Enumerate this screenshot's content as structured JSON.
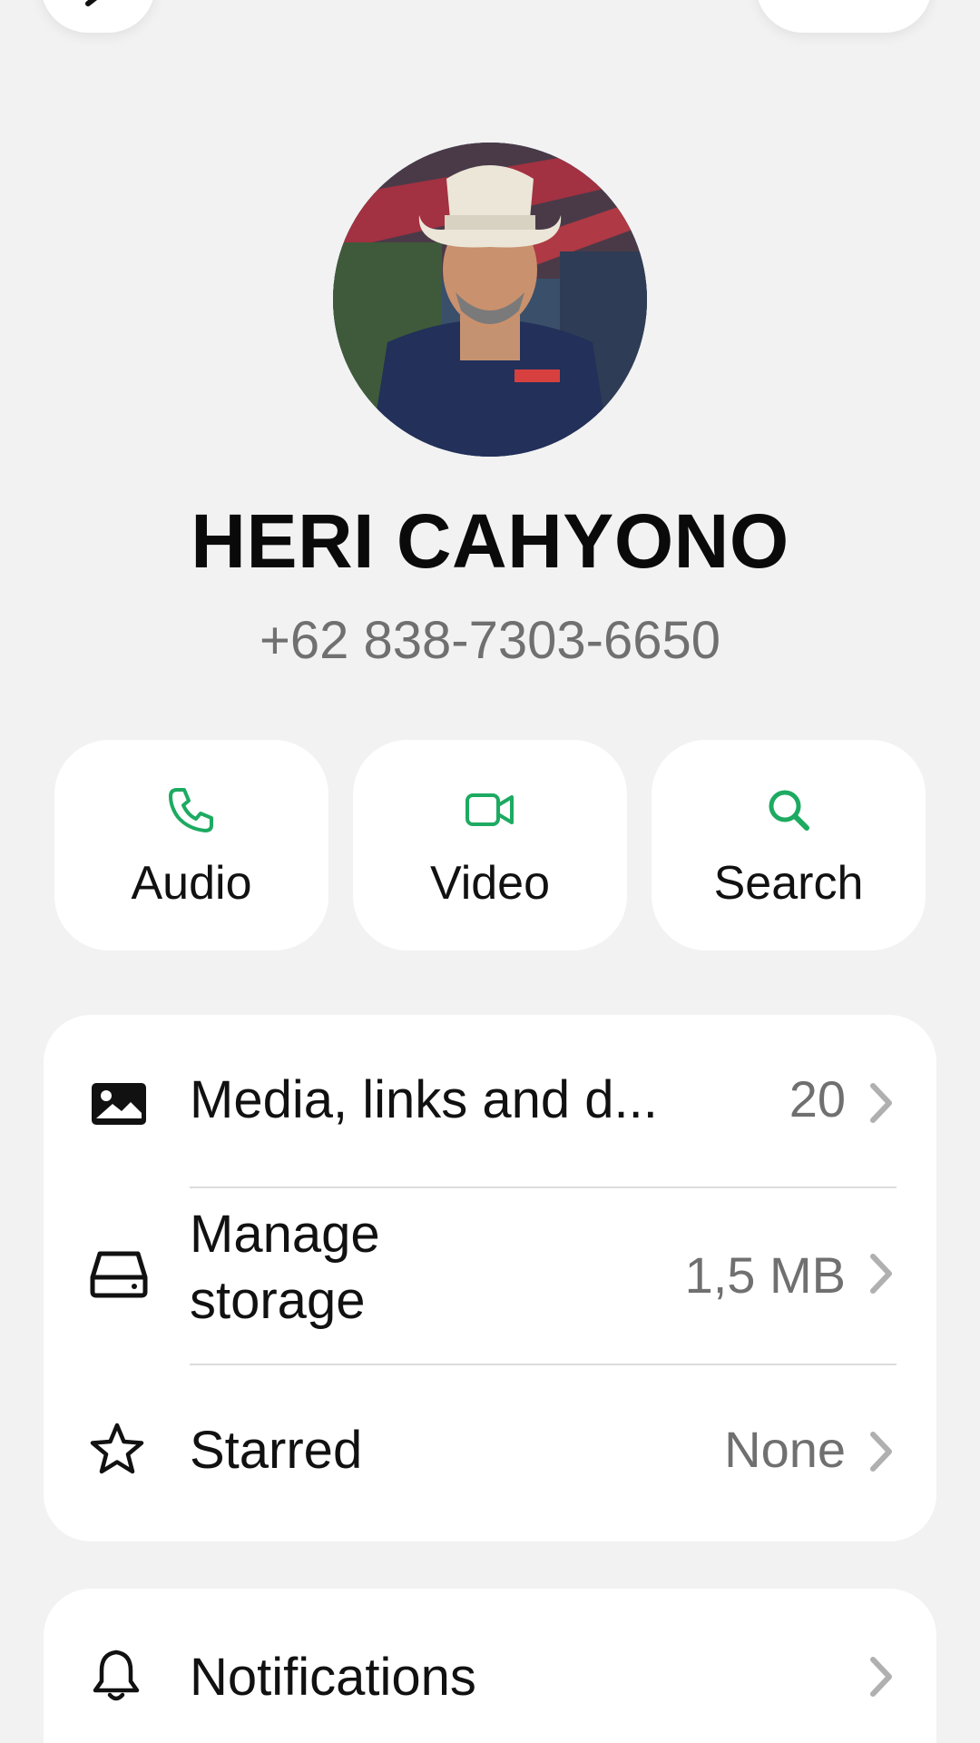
{
  "contact": {
    "name": "HERI CAHYONO",
    "phone": "+62 838-7303-6650"
  },
  "actions": [
    {
      "label": "Audio",
      "icon": "phone-icon"
    },
    {
      "label": "Video",
      "icon": "video-camera-icon"
    },
    {
      "label": "Search",
      "icon": "search-icon"
    }
  ],
  "info_list": [
    {
      "label": "Media, links and d...",
      "value": "20",
      "icon": "image-icon"
    },
    {
      "label": "Manage storage",
      "label_line1": "Manage",
      "label_line2": "storage",
      "value": "1,5 MB",
      "icon": "storage-drive-icon"
    },
    {
      "label": "Starred",
      "value": "None",
      "icon": "star-icon"
    }
  ],
  "settings_list": [
    {
      "label": "Notifications",
      "icon": "bell-icon"
    }
  ],
  "colors": {
    "accent_green": "#1daa61",
    "background": "#f2f2f2",
    "card": "#ffffff",
    "secondary_text": "#707070"
  }
}
